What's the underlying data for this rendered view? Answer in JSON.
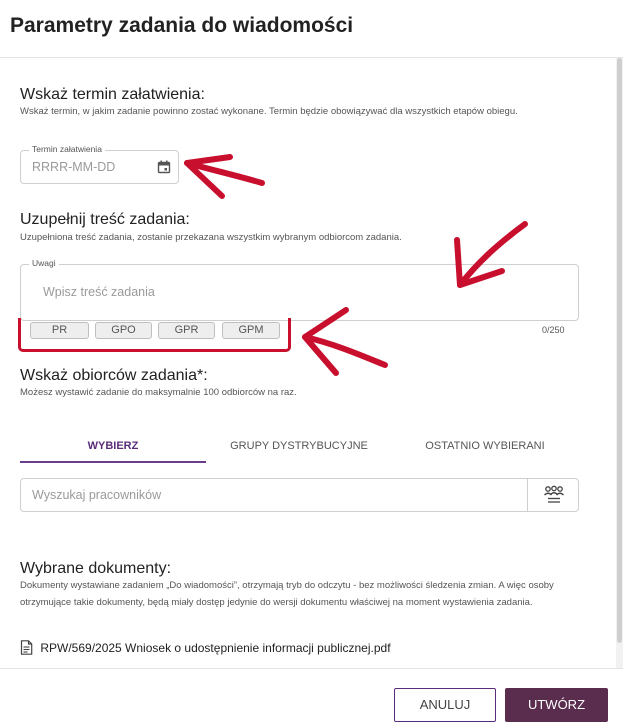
{
  "dialog": {
    "title": "Parametry zadania do wiadomości"
  },
  "deadline": {
    "title": "Wskaż termin załatwienia:",
    "description": "Wskaż termin, w jakim zadanie powinno zostać wykonane. Termin będzie obowiązywać dla wszystkich etapów obiegu.",
    "field_label": "Termin załatwienia",
    "placeholder": "RRRR-MM-DD",
    "icon": "calendar-icon"
  },
  "content": {
    "title": "Uzupełnij treść zadania:",
    "description": "Uzupełniona treść zadania, zostanie przekazana wszystkim wybranym odbiorcom zadania.",
    "field_label": "Uwagi",
    "placeholder": "Wpisz treść zadania",
    "counter": "0/250",
    "chips": [
      "PR",
      "GPO",
      "GPR",
      "GPM"
    ]
  },
  "recipients": {
    "title": "Wskaż obiorców zadania*:",
    "description": "Możesz wystawić zadanie do maksymalnie 100 odbiorców na raz.",
    "tabs": [
      "WYBIERZ",
      "GRUPY DYSTRYBUCYJNE",
      "OSTATNIO WYBIERANI"
    ],
    "active_tab": 0,
    "search_placeholder": "Wyszukaj pracowników",
    "search_icon": "people-list-icon"
  },
  "documents": {
    "title": "Wybrane dokumenty:",
    "description": "Dokumenty wystawiane zadaniem „Do wiadomości”, otrzymają tryb do odczytu - bez możliwości śledzenia zmian. A więc osoby otrzymujące takie dokumenty, będą miały dostęp jedynie do wersji dokumentu właściwej na moment wystawienia zadania.",
    "files": [
      {
        "name": "RPW/569/2025 Wniosek o udostępnienie informacji publicznej.pdf",
        "icon": "document-icon"
      }
    ]
  },
  "footer": {
    "cancel_label": "ANULUJ",
    "create_label": "UTWÓRZ"
  },
  "colors": {
    "accent": "#5a2d4f",
    "tab_accent": "#6a3d8a",
    "annotation_red": "#c8102e"
  }
}
